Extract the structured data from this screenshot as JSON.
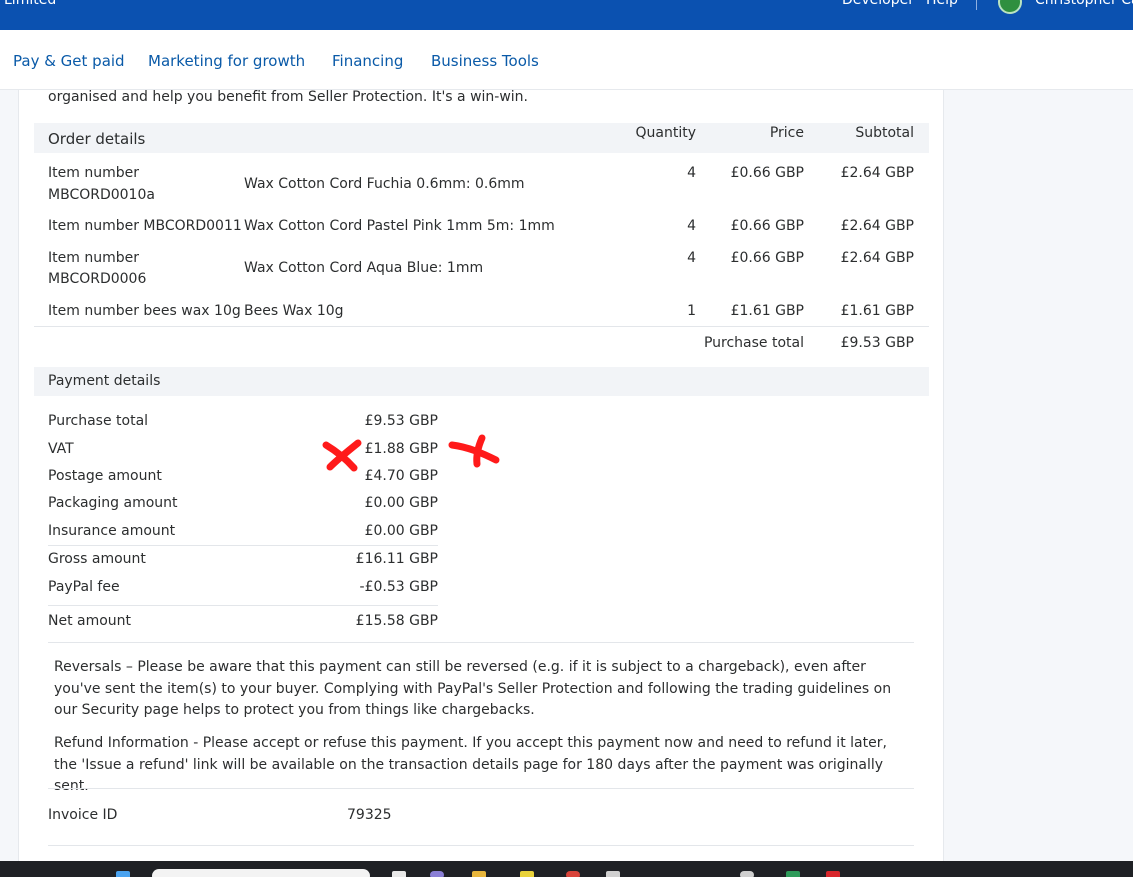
{
  "topbar": {
    "brand": "Limited",
    "developer": "Developer",
    "help": "Help",
    "user": "Christopher Ca"
  },
  "nav": {
    "items": [
      "Pay & Get paid",
      "Marketing for growth",
      "Financing",
      "Business Tools"
    ]
  },
  "intro": "organised and help you benefit from Seller Protection. It's a win-win.",
  "order": {
    "headers": {
      "details": "Order details",
      "quantity": "Quantity",
      "price": "Price",
      "subtotal": "Subtotal"
    },
    "rows": [
      {
        "item_l1": "Item number",
        "item_l2": "MBCORD0010a",
        "desc": "Wax Cotton Cord Fuchia 0.6mm: 0.6mm",
        "qty": "4",
        "price": "£0.66 GBP",
        "subtotal": "£2.64 GBP"
      },
      {
        "item_l1": "Item number MBCORD0011",
        "item_l2": "",
        "desc": "Wax Cotton Cord Pastel Pink 1mm 5m: 1mm",
        "qty": "4",
        "price": "£0.66 GBP",
        "subtotal": "£2.64 GBP"
      },
      {
        "item_l1": "Item number",
        "item_l2": "MBCORD0006",
        "desc": "Wax Cotton Cord Aqua Blue: 1mm",
        "qty": "4",
        "price": "£0.66 GBP",
        "subtotal": "£2.64 GBP"
      },
      {
        "item_l1": "Item number bees wax 10g",
        "item_l2": "",
        "desc": "Bees Wax 10g",
        "qty": "1",
        "price": "£1.61 GBP",
        "subtotal": "£1.61 GBP"
      }
    ],
    "purchase_total_label": "Purchase total",
    "purchase_total_value": "£9.53 GBP"
  },
  "payment": {
    "header": "Payment details",
    "rows": [
      {
        "label": "Purchase total",
        "value": "£9.53 GBP"
      },
      {
        "label": "VAT",
        "value": "£1.88 GBP"
      },
      {
        "label": "Postage amount",
        "value": "£4.70 GBP"
      },
      {
        "label": "Packaging amount",
        "value": "£0.00 GBP"
      },
      {
        "label": "Insurance amount",
        "value": "£0.00 GBP"
      },
      {
        "label": "Gross amount",
        "value": "£16.11 GBP"
      },
      {
        "label": "PayPal fee",
        "value": "-£0.53 GBP"
      },
      {
        "label": "Net amount",
        "value": "£15.58 GBP"
      }
    ]
  },
  "notes": {
    "reversals": "Reversals – Please be aware that this payment can still be reversed (e.g. if it is subject to a chargeback), even after you've sent the item(s) to your buyer. Complying with PayPal's Seller Protection and following the trading guidelines on our Security page helps to protect you from things like chargebacks.",
    "refund": "Refund Information - Please accept or refuse this payment. If you accept this payment now and need to refund it later, the 'Issue a refund' link will be available on the transaction details page for 180 days after the payment was originally sent."
  },
  "invoice": {
    "label": "Invoice ID",
    "value": "79325"
  },
  "annotations": {
    "mark_color": "#ff1a1a",
    "mark_icon": "red-x-mark"
  }
}
